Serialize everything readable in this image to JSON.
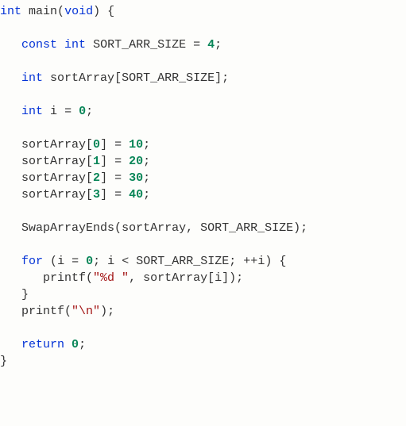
{
  "code": {
    "l1": {
      "kw_int": "int",
      "main": "main",
      "lp": "(",
      "void": "void",
      "rp": ")",
      "ob": "{"
    },
    "l2": "",
    "l3": {
      "ind": "   ",
      "const": "const",
      "sp1": " ",
      "int": "int",
      "sp2": " ",
      "name": "SORT_ARR_SIZE",
      "sp3": " ",
      "eq": "=",
      "sp4": " ",
      "val": "4",
      "semi": ";"
    },
    "l4": "",
    "l5": {
      "ind": "   ",
      "int": "int",
      "sp": " ",
      "name": "sortArray",
      "lb": "[",
      "size": "SORT_ARR_SIZE",
      "rb": "]",
      "semi": ";"
    },
    "l6": "",
    "l7": {
      "ind": "   ",
      "int": "int",
      "sp": " ",
      "name": "i",
      "sp2": " ",
      "eq": "=",
      "sp3": " ",
      "val": "0",
      "semi": ";"
    },
    "l8": "",
    "l9": {
      "ind": "   ",
      "arr": "sortArray",
      "lb": "[",
      "idx": "0",
      "rb": "]",
      "sp": " ",
      "eq": "=",
      "sp2": " ",
      "val": "10",
      "semi": ";"
    },
    "l10": {
      "ind": "   ",
      "arr": "sortArray",
      "lb": "[",
      "idx": "1",
      "rb": "]",
      "sp": " ",
      "eq": "=",
      "sp2": " ",
      "val": "20",
      "semi": ";"
    },
    "l11": {
      "ind": "   ",
      "arr": "sortArray",
      "lb": "[",
      "idx": "2",
      "rb": "]",
      "sp": " ",
      "eq": "=",
      "sp2": " ",
      "val": "30",
      "semi": ";"
    },
    "l12": {
      "ind": "   ",
      "arr": "sortArray",
      "lb": "[",
      "idx": "3",
      "rb": "]",
      "sp": " ",
      "eq": "=",
      "sp2": " ",
      "val": "40",
      "semi": ";"
    },
    "l13": "",
    "l14": {
      "ind": "   ",
      "fn": "SwapArrayEnds",
      "lp": "(",
      "a1": "sortArray",
      "comma": ",",
      "sp": " ",
      "a2": "SORT_ARR_SIZE",
      "rp": ")",
      "semi": ";"
    },
    "l15": "",
    "l16": {
      "ind": "   ",
      "for": "for",
      "sp": " ",
      "lp": "(",
      "i1": "i",
      "sp2": " ",
      "eq": "=",
      "sp3": " ",
      "z": "0",
      "semi1": ";",
      "sp4": " ",
      "i2": "i",
      "sp5": " ",
      "lt": "<",
      "sp6": " ",
      "size": "SORT_ARR_SIZE",
      "semi2": ";",
      "sp7": " ",
      "inc": "++",
      "i3": "i",
      "rp": ")",
      "sp8": " ",
      "ob": "{"
    },
    "l17": {
      "ind": "      ",
      "fn": "printf",
      "lp": "(",
      "str": "\"%d \"",
      "comma": ",",
      "sp": " ",
      "arr": "sortArray",
      "lb": "[",
      "i": "i",
      "rb": "]",
      "rp": ")",
      "semi": ";"
    },
    "l18": {
      "ind": "   ",
      "cb": "}"
    },
    "l19": {
      "ind": "   ",
      "fn": "printf",
      "lp": "(",
      "str": "\"\\n\"",
      "rp": ")",
      "semi": ";"
    },
    "l20": "",
    "l21": {
      "ind": "   ",
      "ret": "return",
      "sp": " ",
      "val": "0",
      "semi": ";"
    },
    "l22": {
      "cb": "}"
    }
  }
}
